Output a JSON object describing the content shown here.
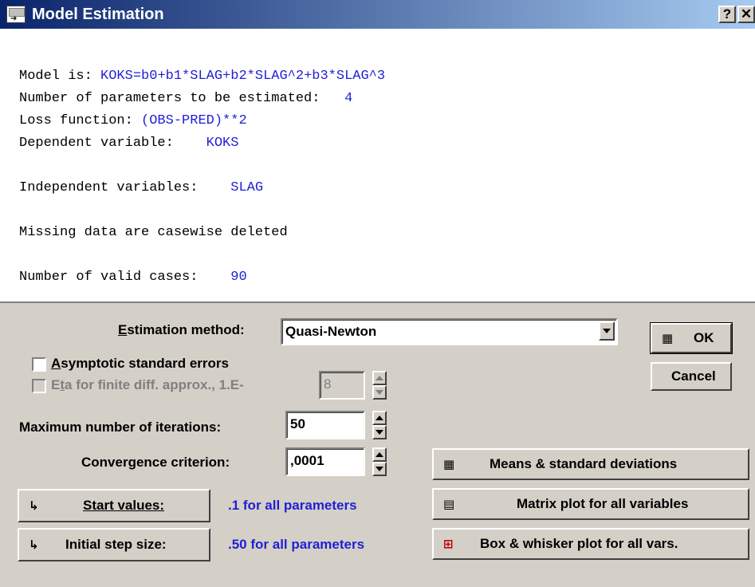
{
  "window": {
    "title": "Model Estimation",
    "help_glyph": "?",
    "close_glyph": "✕"
  },
  "output": {
    "model_label": "Model is:",
    "model_value": "KOKS=b0+b1*SLAG+b2*SLAG^2+b3*SLAG^3",
    "params_label": "Number of parameters to be estimated:",
    "params_value": "4",
    "loss_label": "Loss function:",
    "loss_value": "(OBS-PRED)**2",
    "dep_label": "Dependent variable:",
    "dep_value": "KOKS",
    "indep_label": "Independent variables:",
    "indep_value": "SLAG",
    "missing_text": "Missing data are casewise deleted",
    "cases_label": "Number of valid cases:",
    "cases_value": "90"
  },
  "form": {
    "estimation_method_label": "Estimation method:",
    "estimation_method_value": "Quasi-Newton",
    "asymptotic_label": "Asymptotic standard errors",
    "asymptotic_checked": false,
    "eta_label": "Eta for finite diff. approx., 1.E-",
    "eta_value": "8",
    "eta_checked": false,
    "max_iter_label": "Maximum number of iterations:",
    "max_iter_value": "50",
    "convergence_label": "Convergence criterion:",
    "convergence_value": ",0001"
  },
  "buttons": {
    "ok": "OK",
    "cancel": "Cancel",
    "start_values": "Start values:",
    "start_values_note": ".1 for all parameters",
    "step_size": "Initial step size:",
    "step_size_note": ".50 for all parameters",
    "means": "Means & standard deviations",
    "matrix": "Matrix plot for all variables",
    "boxwhisker": "Box & whisker plot for all vars."
  },
  "colors": {
    "value_text": "#1f1fd6",
    "titlebar_start": "#0a246a",
    "titlebar_end": "#a6caf0",
    "face": "#d4d0c8"
  }
}
